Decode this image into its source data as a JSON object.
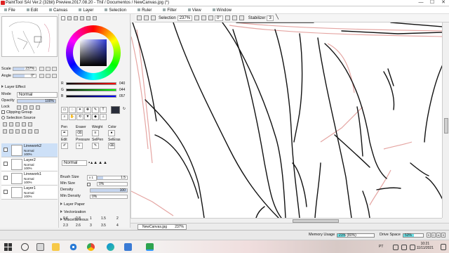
{
  "window": {
    "title": "PaintTool SAI Ver.2 (32bit) Preview.2017.08.20 - Thiỉ / Documentos / NewCanvas.jpg (*)",
    "controls": [
      "—",
      "☐",
      "✕"
    ]
  },
  "menu": [
    "File",
    "Edit",
    "Canvas",
    "Layer",
    "Selection",
    "Ruler",
    "Filter",
    "View",
    "Window"
  ],
  "toolbar": {
    "selection_label": "Selection",
    "zoom": "237%",
    "angle": "0°",
    "stabilizer_label": "Stabilizer",
    "stabilizer_value": "3"
  },
  "navigator": {
    "scale_label": "Scale",
    "scale_value": "237%",
    "angle_label": "Angle",
    "angle_value": "0°"
  },
  "layer_effect": {
    "header": "Layer Effect",
    "mode_label": "Mode",
    "mode_value": "Normal",
    "opacity_label": "Opacity",
    "opacity_value": "100%",
    "opacity_fraction": 1.0,
    "lock_label": "Lock",
    "clipping_group": "Clipping Group",
    "selection_source": "Selection Source"
  },
  "layers": [
    {
      "name": "Linework2",
      "mode": "Normal",
      "opacity": "100%",
      "selected": true
    },
    {
      "name": "Layer2",
      "mode": "Normal",
      "opacity": "100%",
      "selected": false
    },
    {
      "name": "Linework1",
      "mode": "Normal",
      "opacity": "100%",
      "selected": false
    },
    {
      "name": "Layer1",
      "mode": "Normal",
      "opacity": "100%",
      "selected": false
    }
  ],
  "color": {
    "r_label": "R",
    "r_value": "040",
    "g_label": "G",
    "g_value": "044",
    "b_label": "B",
    "b_value": "057",
    "current": "#282c39"
  },
  "tool_tabs": [
    "Pen",
    "Eraser",
    "Weight",
    "Color",
    "Edit",
    "Pressure",
    "SelPen",
    "SelEras"
  ],
  "brush": {
    "mode_value": "Normal",
    "size_label": "Brush Size",
    "size_multiplier": "x 1",
    "size_value": "1.5",
    "min_size_label": "Min Size",
    "min_size_value": "0%",
    "density_label": "Density",
    "density_value": "100",
    "min_density_label": "Min Density",
    "min_density_value": "0%"
  },
  "sections": [
    "Layer Paper",
    "Vectorization",
    "Miscellaneous"
  ],
  "size_presets": [
    "0.6",
    "0.8",
    "1",
    "1.5",
    "2",
    "2.3",
    "2.6",
    "3",
    "3.5",
    "4"
  ],
  "document_tab": {
    "filename": "NewCanvas.jpg",
    "zoom": "237%"
  },
  "status": {
    "memory_label": "Memory Usage",
    "memory_text": "21% (80%)",
    "memory_fraction": 0.21,
    "drive_label": "Drive Space",
    "drive_text": "53%",
    "drive_fraction": 0.53,
    "keys": [
      "S",
      "C",
      "A",
      "S"
    ]
  },
  "taskbar": {
    "lang": "PT",
    "time": "10:21",
    "date": "11/11/2021"
  },
  "colors": {
    "selected_layer": "#cde0f7",
    "meter_fill": "#6fe3e8",
    "pink_stroke": "#e5a5a2"
  }
}
